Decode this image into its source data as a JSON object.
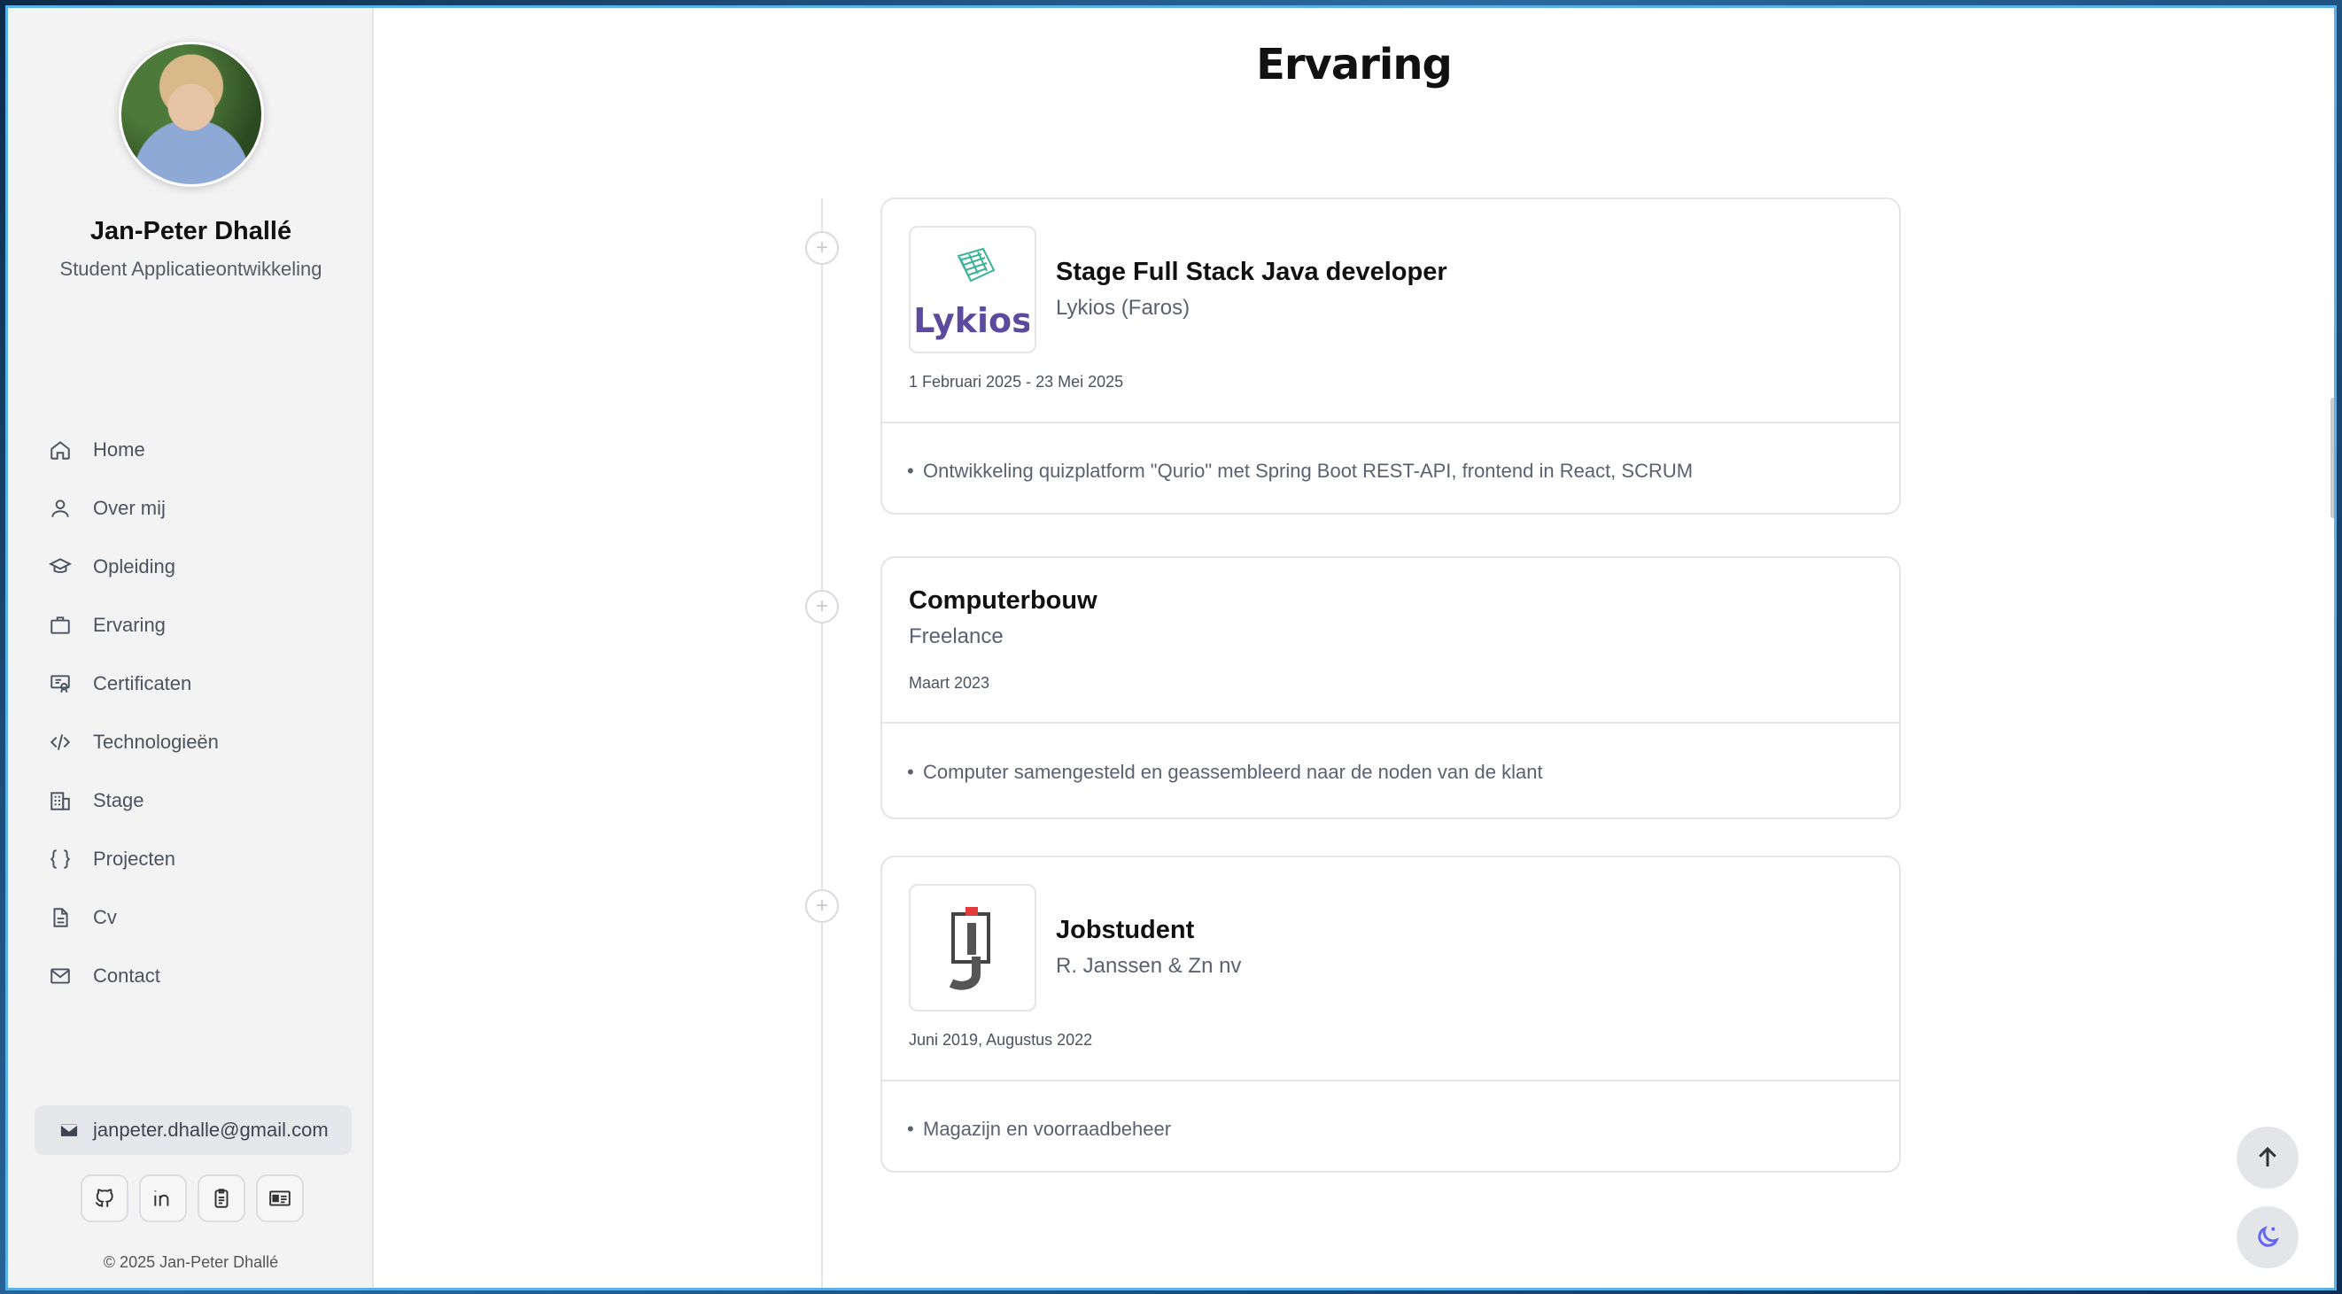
{
  "profile": {
    "name": "Jan-Peter Dhallé",
    "subtitle": "Student Applicatieontwikkeling"
  },
  "sidebar": {
    "items": [
      {
        "label": "Home",
        "icon": "home-icon"
      },
      {
        "label": "Over mij",
        "icon": "user-icon"
      },
      {
        "label": "Opleiding",
        "icon": "graduation-cap-icon"
      },
      {
        "label": "Ervaring",
        "icon": "briefcase-icon"
      },
      {
        "label": "Certificaten",
        "icon": "certificate-icon"
      },
      {
        "label": "Technologieën",
        "icon": "code-icon"
      },
      {
        "label": "Stage",
        "icon": "building-icon"
      },
      {
        "label": "Projecten",
        "icon": "braces-icon"
      },
      {
        "label": "Cv",
        "icon": "document-icon"
      },
      {
        "label": "Contact",
        "icon": "mail-icon"
      }
    ],
    "email": "janpeter.dhalle@gmail.com",
    "socials": [
      "github-icon",
      "linkedin-icon",
      "badge-icon",
      "id-card-icon"
    ],
    "copyright": "© 2025 Jan-Peter Dhallé"
  },
  "main": {
    "title": "Ervaring",
    "experiences": [
      {
        "role": "Stage Full Stack Java developer",
        "company": "Lykios (Faros)",
        "dates": "1 Februari 2025 - 23 Mei 2025",
        "logo_text": "Lykios",
        "bullets": [
          "Ontwikkeling quizplatform \"Qurio\" met Spring Boot REST-API, frontend in React, SCRUM"
        ]
      },
      {
        "role": "Computerbouw",
        "company": "Freelance",
        "dates": "Maart 2023",
        "bullets": [
          "Computer samengesteld en geassembleerd naar de noden van de klant"
        ]
      },
      {
        "role": "Jobstudent",
        "company": "R. Janssen & Zn nv",
        "dates": "Juni 2019, Augustus 2022",
        "bullets": [
          "Magazijn en voorraadbeheer"
        ]
      }
    ]
  },
  "colors": {
    "accent": "#6366f1",
    "sidebar_bg": "#f3f3f4",
    "lykios_purple": "#5b4a9e",
    "lykios_teal": "#3bb39a"
  }
}
